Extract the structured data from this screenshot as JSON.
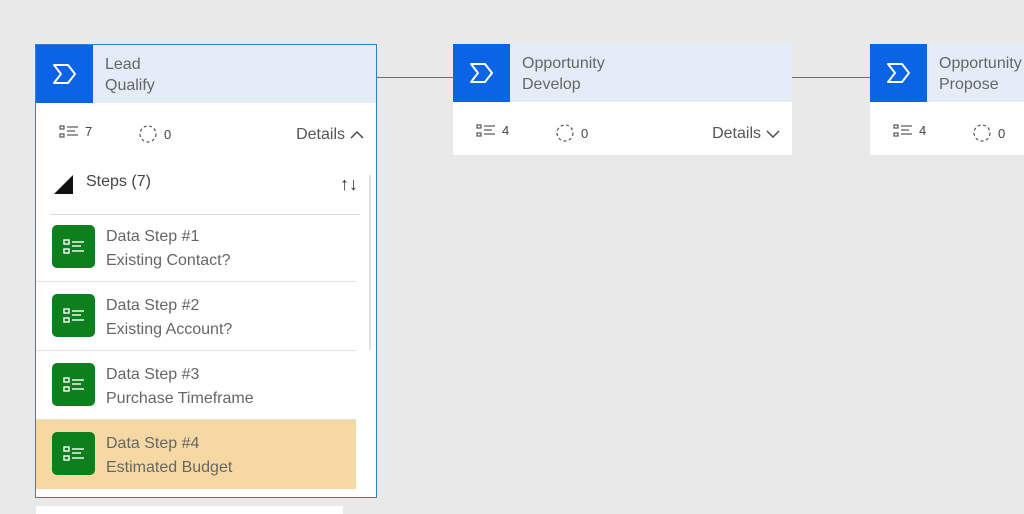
{
  "stages": [
    {
      "line1": "Lead",
      "line2": "Qualify",
      "steps_count": "7",
      "conditions_count": "0",
      "details_label": "Details"
    },
    {
      "line1": "Opportunity",
      "line2": "Develop",
      "steps_count": "4",
      "conditions_count": "0",
      "details_label": "Details"
    },
    {
      "line1": "Opportunity",
      "line2": "Propose",
      "steps_count": "4",
      "conditions_count": "0"
    }
  ],
  "steps_panel": {
    "title": "Steps (7)",
    "sort_label": "↑↓",
    "items": [
      {
        "title": "Data Step #1",
        "subtitle": "Existing Contact?"
      },
      {
        "title": "Data Step #2",
        "subtitle": "Existing Account?"
      },
      {
        "title": "Data Step #3",
        "subtitle": "Purchase Timeframe"
      },
      {
        "title": "Data Step #4",
        "subtitle": "Estimated Budget"
      }
    ]
  },
  "colors": {
    "stage_icon": "#0b63e6",
    "step_icon": "#0d7f1d",
    "selection_border": "#2f7fd6",
    "highlight": "#f6d9a2"
  }
}
